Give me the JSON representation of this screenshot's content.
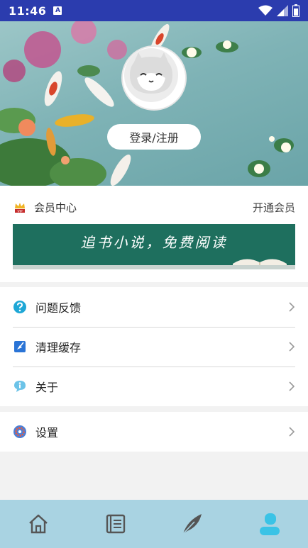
{
  "status_bar": {
    "time": "11:46",
    "notification": "A"
  },
  "header": {
    "login_label": "登录/注册"
  },
  "member": {
    "label": "会员中心",
    "open_label": "开通会员",
    "badge": "VIP",
    "banner_text": "追书小说，免费阅读"
  },
  "menu": [
    {
      "label": "问题反馈",
      "icon": "question-icon"
    },
    {
      "label": "清理缓存",
      "icon": "clean-icon"
    },
    {
      "label": "关于",
      "icon": "info-icon"
    },
    {
      "label": "设置",
      "icon": "settings-icon"
    }
  ],
  "tabs": [
    {
      "icon": "home-icon",
      "active": false
    },
    {
      "icon": "bookshelf-icon",
      "active": false
    },
    {
      "icon": "feather-icon",
      "active": false
    },
    {
      "icon": "profile-icon",
      "active": true
    }
  ],
  "colors": {
    "status_bar": "#2b3cae",
    "tab_bar": "#a9d3e2",
    "tab_active": "#3ac3e6",
    "tab_inactive": "#555555"
  }
}
